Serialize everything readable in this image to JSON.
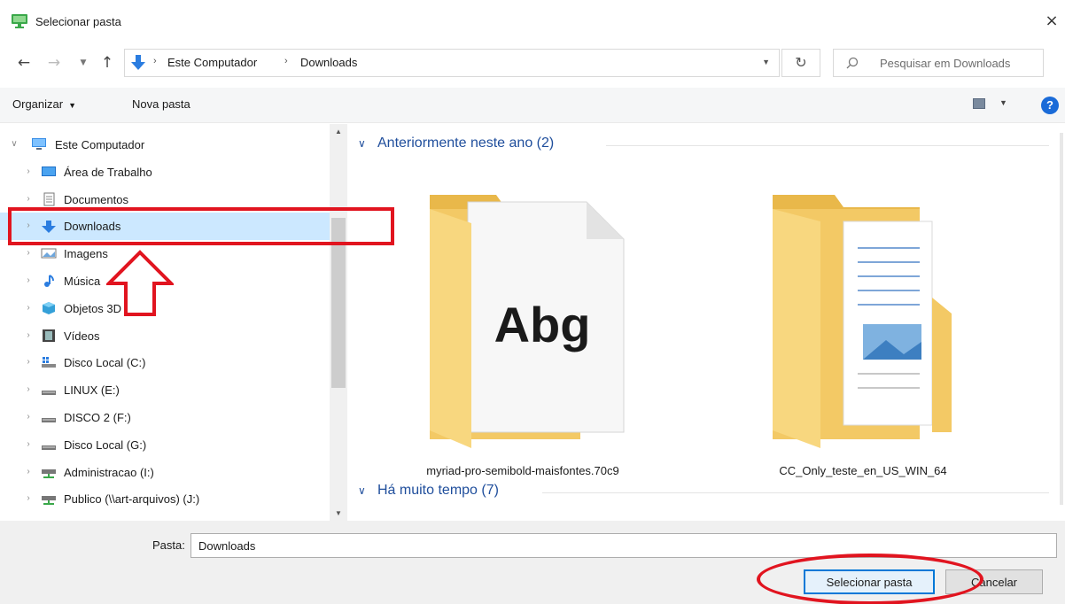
{
  "window": {
    "title": "Selecionar pasta",
    "close_label": "×"
  },
  "address": {
    "crumbs": [
      "Este Computador",
      "Downloads"
    ],
    "separator": "›",
    "search_placeholder": "Pesquisar em Downloads"
  },
  "toolbar": {
    "organize_label": "Organizar",
    "new_folder_label": "Nova pasta",
    "help_label": "?"
  },
  "tree": {
    "items": [
      {
        "label": "Este Computador",
        "icon": "computer-icon",
        "expanded": true,
        "selected": false
      },
      {
        "label": "Área de Trabalho",
        "icon": "desktop-icon",
        "expanded": false,
        "selected": false
      },
      {
        "label": "Documentos",
        "icon": "documents-icon",
        "expanded": false,
        "selected": false
      },
      {
        "label": "Downloads",
        "icon": "downloads-icon",
        "expanded": false,
        "selected": true
      },
      {
        "label": "Imagens",
        "icon": "pictures-icon",
        "expanded": false,
        "selected": false
      },
      {
        "label": "Música",
        "icon": "music-icon",
        "expanded": false,
        "selected": false
      },
      {
        "label": "Objetos 3D",
        "icon": "objects-3d-icon",
        "expanded": false,
        "selected": false
      },
      {
        "label": "Vídeos",
        "icon": "videos-icon",
        "expanded": false,
        "selected": false
      },
      {
        "label": "Disco Local (C:)",
        "icon": "windows-drive-icon",
        "expanded": false,
        "selected": false
      },
      {
        "label": "LINUX (E:)",
        "icon": "drive-icon",
        "expanded": false,
        "selected": false
      },
      {
        "label": "DISCO 2 (F:)",
        "icon": "drive-icon",
        "expanded": false,
        "selected": false
      },
      {
        "label": "Disco Local (G:)",
        "icon": "drive-icon",
        "expanded": false,
        "selected": false
      },
      {
        "label": "Administracao (I:)",
        "icon": "network-drive-icon",
        "expanded": false,
        "selected": false
      },
      {
        "label": "Publico (\\\\art-arquivos) (J:)",
        "icon": "network-drive-icon",
        "expanded": false,
        "selected": false
      }
    ]
  },
  "content": {
    "groups": [
      {
        "label": "Anteriormente neste ano (2)"
      },
      {
        "label": "Há muito tempo (7)"
      }
    ],
    "files": [
      {
        "name": "myriad-pro-semibold-maisfontes.70c9",
        "preview_text": "Abg",
        "icon": "font-folder-icon"
      },
      {
        "name": "CC_Only_teste_en_US_WIN_64",
        "icon": "documents-folder-icon"
      }
    ]
  },
  "footer": {
    "folder_label": "Pasta:",
    "folder_value": "Downloads",
    "select_button": "Selecionar pasta",
    "cancel_button": "Cancelar"
  },
  "colors": {
    "accent": "#0078d7",
    "selection": "#cce8ff",
    "group_header": "#1f4e9c",
    "annotation": "#e1141f",
    "folder": "#f5cf6e"
  }
}
